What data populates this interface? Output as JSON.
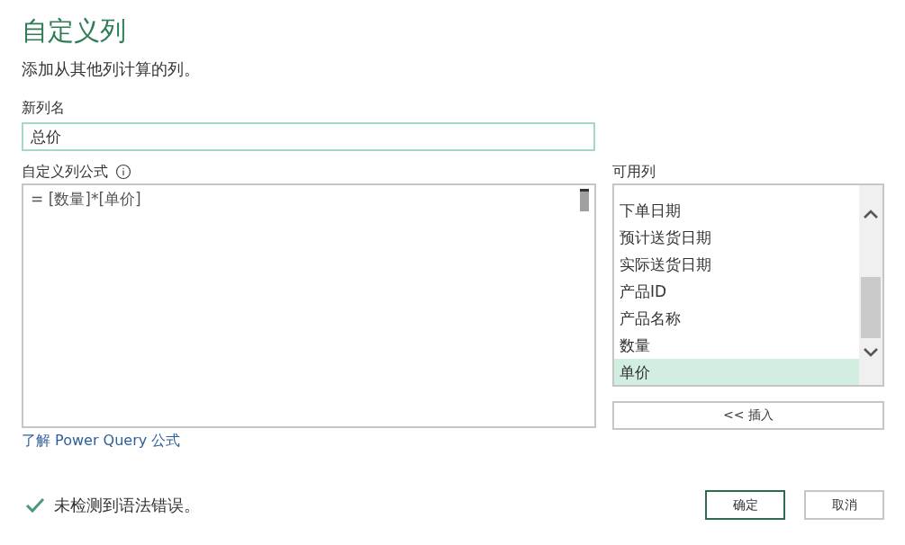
{
  "title": "自定义列",
  "description": "添加从其他列计算的列。",
  "new_column": {
    "label": "新列名",
    "value": "总价"
  },
  "formula": {
    "label": "自定义列公式",
    "value": "= [数量]*[单价]"
  },
  "available_columns": {
    "label": "可用列",
    "items": [
      {
        "label": "下单日期",
        "selected": false
      },
      {
        "label": "预计送货日期",
        "selected": false
      },
      {
        "label": "实际送货日期",
        "selected": false
      },
      {
        "label": "产品ID",
        "selected": false
      },
      {
        "label": "产品名称",
        "selected": false
      },
      {
        "label": "数量",
        "selected": false
      },
      {
        "label": "单价",
        "selected": true
      }
    ],
    "insert_button": "<< 插入"
  },
  "help_link": "了解 Power Query 公式",
  "status": "未检测到语法错误。",
  "buttons": [
    {
      "label": "确定",
      "kind": "primary"
    },
    {
      "label": "取消",
      "kind": "secondary"
    }
  ]
}
